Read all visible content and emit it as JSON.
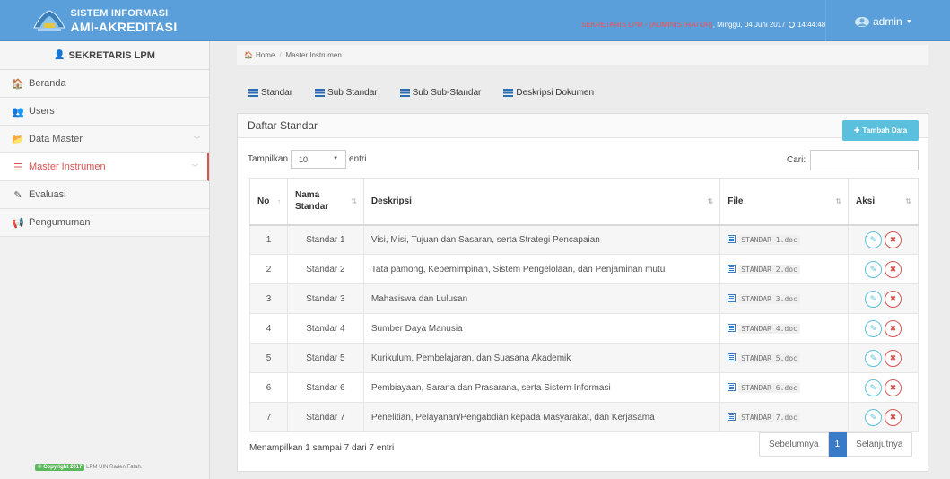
{
  "header": {
    "brand_line1": "SISTEM INFORMASI",
    "brand_line2": "AMI-AKREDITASI",
    "role_text": "SEKRETARIS LPM - (ADMINISTRATOR)",
    "datetime_text": ", Minggu, 04 Juni 2017 ",
    "time_text": " 14:44:48",
    "user_label": "admin",
    "logo_icon": "university-logo-icon"
  },
  "sidebar": {
    "title": "SEKRETARIS LPM",
    "items": [
      {
        "label": "Beranda",
        "icon": "home-icon",
        "glyph": "🏠"
      },
      {
        "label": "Users",
        "icon": "users-icon",
        "glyph": "👥"
      },
      {
        "label": "Data Master",
        "icon": "folder-icon",
        "glyph": "📂"
      },
      {
        "label": "Master Instrumen",
        "icon": "list-icon",
        "glyph": "☰"
      },
      {
        "label": "Evaluasi",
        "icon": "edit-icon",
        "glyph": "✎"
      },
      {
        "label": "Pengumuman",
        "icon": "bullhorn-icon",
        "glyph": "📢"
      }
    ],
    "footer_badge": "© Copyright 2017",
    "footer_text": "LPM UIN Raden Fatah."
  },
  "breadcrumb": {
    "home": "Home",
    "current": "Master Instrumen"
  },
  "tabs": [
    "Standar",
    "Sub Standar",
    "Sub Sub-Standar",
    "Deskripsi Dokumen"
  ],
  "panel": {
    "title": "Daftar Standar",
    "add_button": "Tambah Data",
    "show_label": "Tampilkan",
    "show_value": "10",
    "entries_label": "entri",
    "search_label": "Cari:",
    "search_value": ""
  },
  "table": {
    "columns": [
      "No",
      "Nama Standar",
      "Deskripsi",
      "File",
      "Aksi"
    ],
    "rows": [
      {
        "no": "1",
        "name": "Standar 1",
        "desc": "Visi, Misi, Tujuan dan Sasaran, serta Strategi Pencapaian",
        "file": "STANDAR 1.doc"
      },
      {
        "no": "2",
        "name": "Standar 2",
        "desc": "Tata pamong, Kepemimpinan, Sistem Pengelolaan, dan Penjaminan mutu",
        "file": "STANDAR 2.doc"
      },
      {
        "no": "3",
        "name": "Standar 3",
        "desc": "Mahasiswa dan Lulusan",
        "file": "STANDAR 3.doc"
      },
      {
        "no": "4",
        "name": "Standar 4",
        "desc": "Sumber Daya Manusia",
        "file": "STANDAR 4.doc"
      },
      {
        "no": "5",
        "name": "Standar 5",
        "desc": "Kurikulum, Pembelajaran, dan Suasana Akademik",
        "file": "STANDAR 5.doc"
      },
      {
        "no": "6",
        "name": "Standar 6",
        "desc": "Pembiayaan, Sarana dan Prasarana, serta Sistem Informasi",
        "file": "STANDAR 6.doc"
      },
      {
        "no": "7",
        "name": "Standar 7",
        "desc": "Penelitian, Pelayanan/Pengabdian kepada Masyarakat, dan Kerjasama",
        "file": "STANDAR 7.doc"
      }
    ]
  },
  "footer": {
    "info": "Menampilkan 1 sampai 7 dari 7 entri",
    "prev": "Sebelumnya",
    "page": "1",
    "next": "Selanjutnya"
  },
  "colors": {
    "header_bg": "#5a9fd9",
    "active_menu": "#d9534f",
    "add_button": "#5bc0de",
    "pager_active": "#3a7bc8"
  }
}
